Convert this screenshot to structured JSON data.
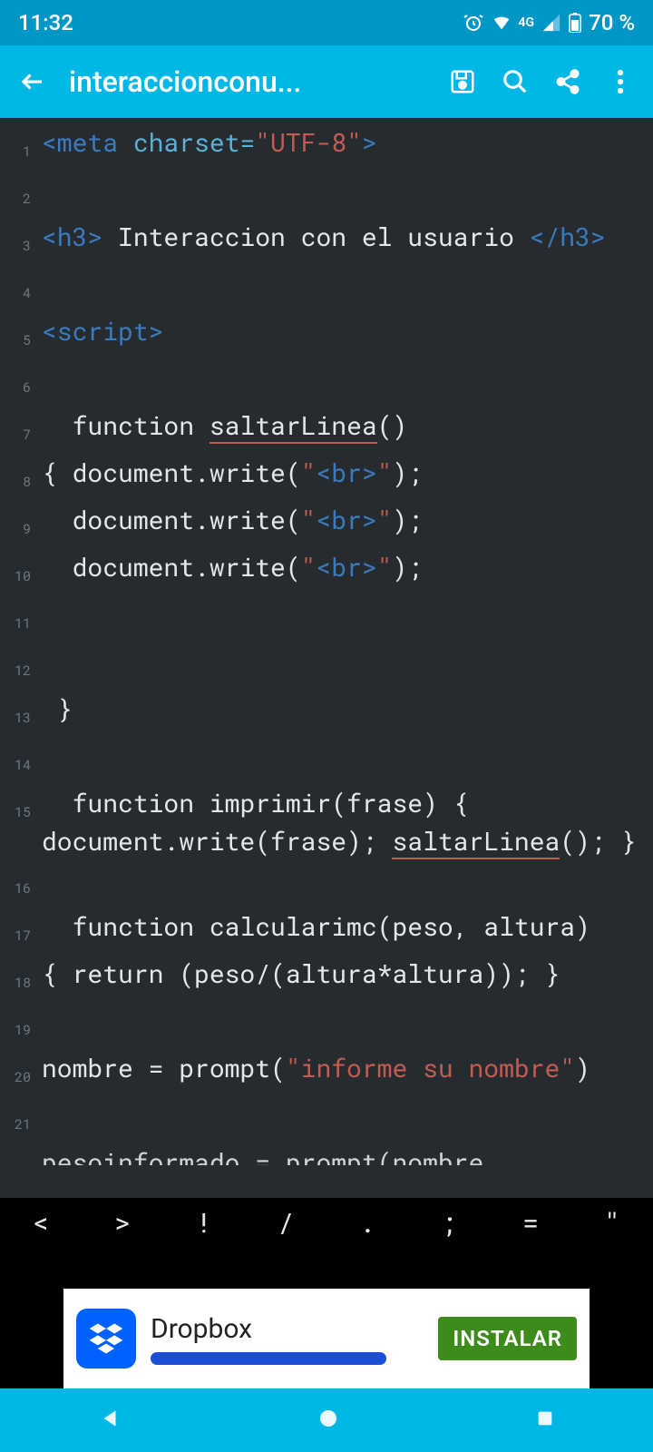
{
  "status": {
    "time": "11:32",
    "net": "4G",
    "battery": "70 %"
  },
  "appbar": {
    "title": "interaccionconu..."
  },
  "lines": [
    {
      "n": "1",
      "html": "<span class='tag'>&lt;meta</span> <span class='attr'>charset=</span><span class='str'>\"UTF-8\"</span><span class='tag'>&gt;</span>"
    },
    {
      "n": "2",
      "html": ""
    },
    {
      "n": "3",
      "html": "<span class='tag'>&lt;h3&gt;</span> Interaccion con el usuario <span class='tag'>&lt;/h3&gt;</span>"
    },
    {
      "n": "4",
      "html": ""
    },
    {
      "n": "5",
      "html": "<span class='tag'>&lt;script&gt;</span>"
    },
    {
      "n": "6",
      "html": ""
    },
    {
      "n": "7",
      "html": "  function <span class='ul'>saltarLinea</span>() "
    },
    {
      "n": "8",
      "html": "{ document.write(<span class='str'>\"</span><span class='tag'>&lt;br&gt;</span><span class='str'>\"</span>);"
    },
    {
      "n": "9",
      "html": "  document.write(<span class='str'>\"</span><span class='tag'>&lt;br&gt;</span><span class='str'>\"</span>);"
    },
    {
      "n": "10",
      "html": "  document.write(<span class='str'>\"</span><span class='tag'>&lt;br&gt;</span><span class='str'>\"</span>);"
    },
    {
      "n": "11",
      "html": ""
    },
    {
      "n": "12",
      "html": ""
    },
    {
      "n": "13",
      "html": " }"
    },
    {
      "n": "14",
      "html": ""
    },
    {
      "n": "15",
      "html": "  function imprimir(frase) { document.write(frase); <span class='ul'>saltarLinea</span>(); }"
    },
    {
      "n": "16",
      "html": ""
    },
    {
      "n": "17",
      "html": "  function calcularimc(peso, altura)"
    },
    {
      "n": "18",
      "html": "{ return (peso/(altura*altura)); }"
    },
    {
      "n": "19",
      "html": ""
    },
    {
      "n": "20",
      "html": "nombre = prompt(<span class='str'>\"informe su nombre\"</span>)"
    },
    {
      "n": "21",
      "html": ""
    }
  ],
  "partial_line": "pesoinformado = prompt(nombre",
  "symbols": [
    "<",
    ">",
    "!",
    "/",
    ".",
    ";",
    "=",
    "\""
  ],
  "ad": {
    "title": "Dropbox",
    "cta": "INSTALAR"
  }
}
